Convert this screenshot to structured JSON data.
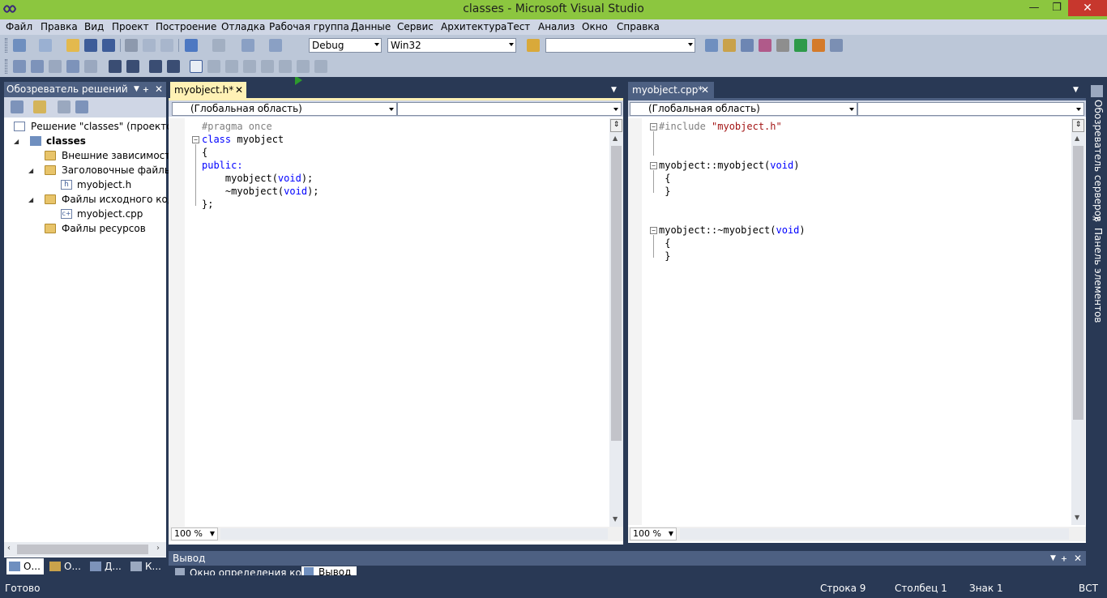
{
  "window": {
    "title": "classes - Microsoft Visual Studio",
    "minimize_glyph": "—",
    "restore_glyph": "❐",
    "close_glyph": "✕"
  },
  "menu": [
    "Файл",
    "Правка",
    "Вид",
    "Проект",
    "Построение",
    "Отладка",
    "Рабочая группа",
    "Данные",
    "Сервис",
    "Архитектура",
    "Тест",
    "Анализ",
    "Окно",
    "Справка"
  ],
  "toolbar": {
    "configuration": "Debug",
    "platform": "Win32",
    "find_value": ""
  },
  "solution_explorer": {
    "title": "Обозреватель решений",
    "pin_glyph": "ᚐ",
    "close_glyph": "✕",
    "items": {
      "solution": "Решение \"classes\"  (проектов:",
      "project": "classes",
      "external": "Внешние зависимости",
      "headers": "Заголовочные файлы",
      "header_file": "myobject.h",
      "sources": "Файлы исходного кода",
      "source_file": "myobject.cpp",
      "resources": "Файлы ресурсов"
    },
    "bottom_tabs": [
      "О...",
      "О...",
      "Д...",
      "К..."
    ]
  },
  "left_editor": {
    "tab": "myobject.h*",
    "scope": "(Глобальная область)",
    "member": "",
    "zoom": "100 %",
    "code": {
      "l1_pp": "#pragma once",
      "l2_kw": "class",
      "l2_name": " myobject",
      "l3": "{",
      "l4_kw": "public:",
      "l5_fn": "    myobject(",
      "l5_kw": "void",
      "l5_end": ");",
      "l6_fn": "    ~myobject(",
      "l6_kw": "void",
      "l6_end": ");",
      "l7": "};"
    }
  },
  "right_editor": {
    "tab": "myobject.cpp*",
    "scope": "(Глобальная область)",
    "member": "",
    "zoom": "100 %",
    "code": {
      "l1_pp": "#include",
      "l1_str": " \"myobject.h\"",
      "l4_fn": "myobject::myobject(",
      "l4_kw": "void",
      "l4_end": ")",
      "l5": " {",
      "l6": " }",
      "l9_fn": "myobject::~myobject(",
      "l9_kw": "void",
      "l9_end": ")",
      "l10": " {",
      "l11": " }"
    }
  },
  "output": {
    "title": "Вывод",
    "tabs": [
      "Окно определения кода",
      "Вывод"
    ]
  },
  "right_toolbox": {
    "server_explorer": "Обозреватель серверов",
    "toolbox": "Панель элементов"
  },
  "statusbar": {
    "ready": "Готово",
    "line": "Строка 9",
    "column": "Столбец 1",
    "char": "Знак 1",
    "mode": "ВСТ"
  }
}
